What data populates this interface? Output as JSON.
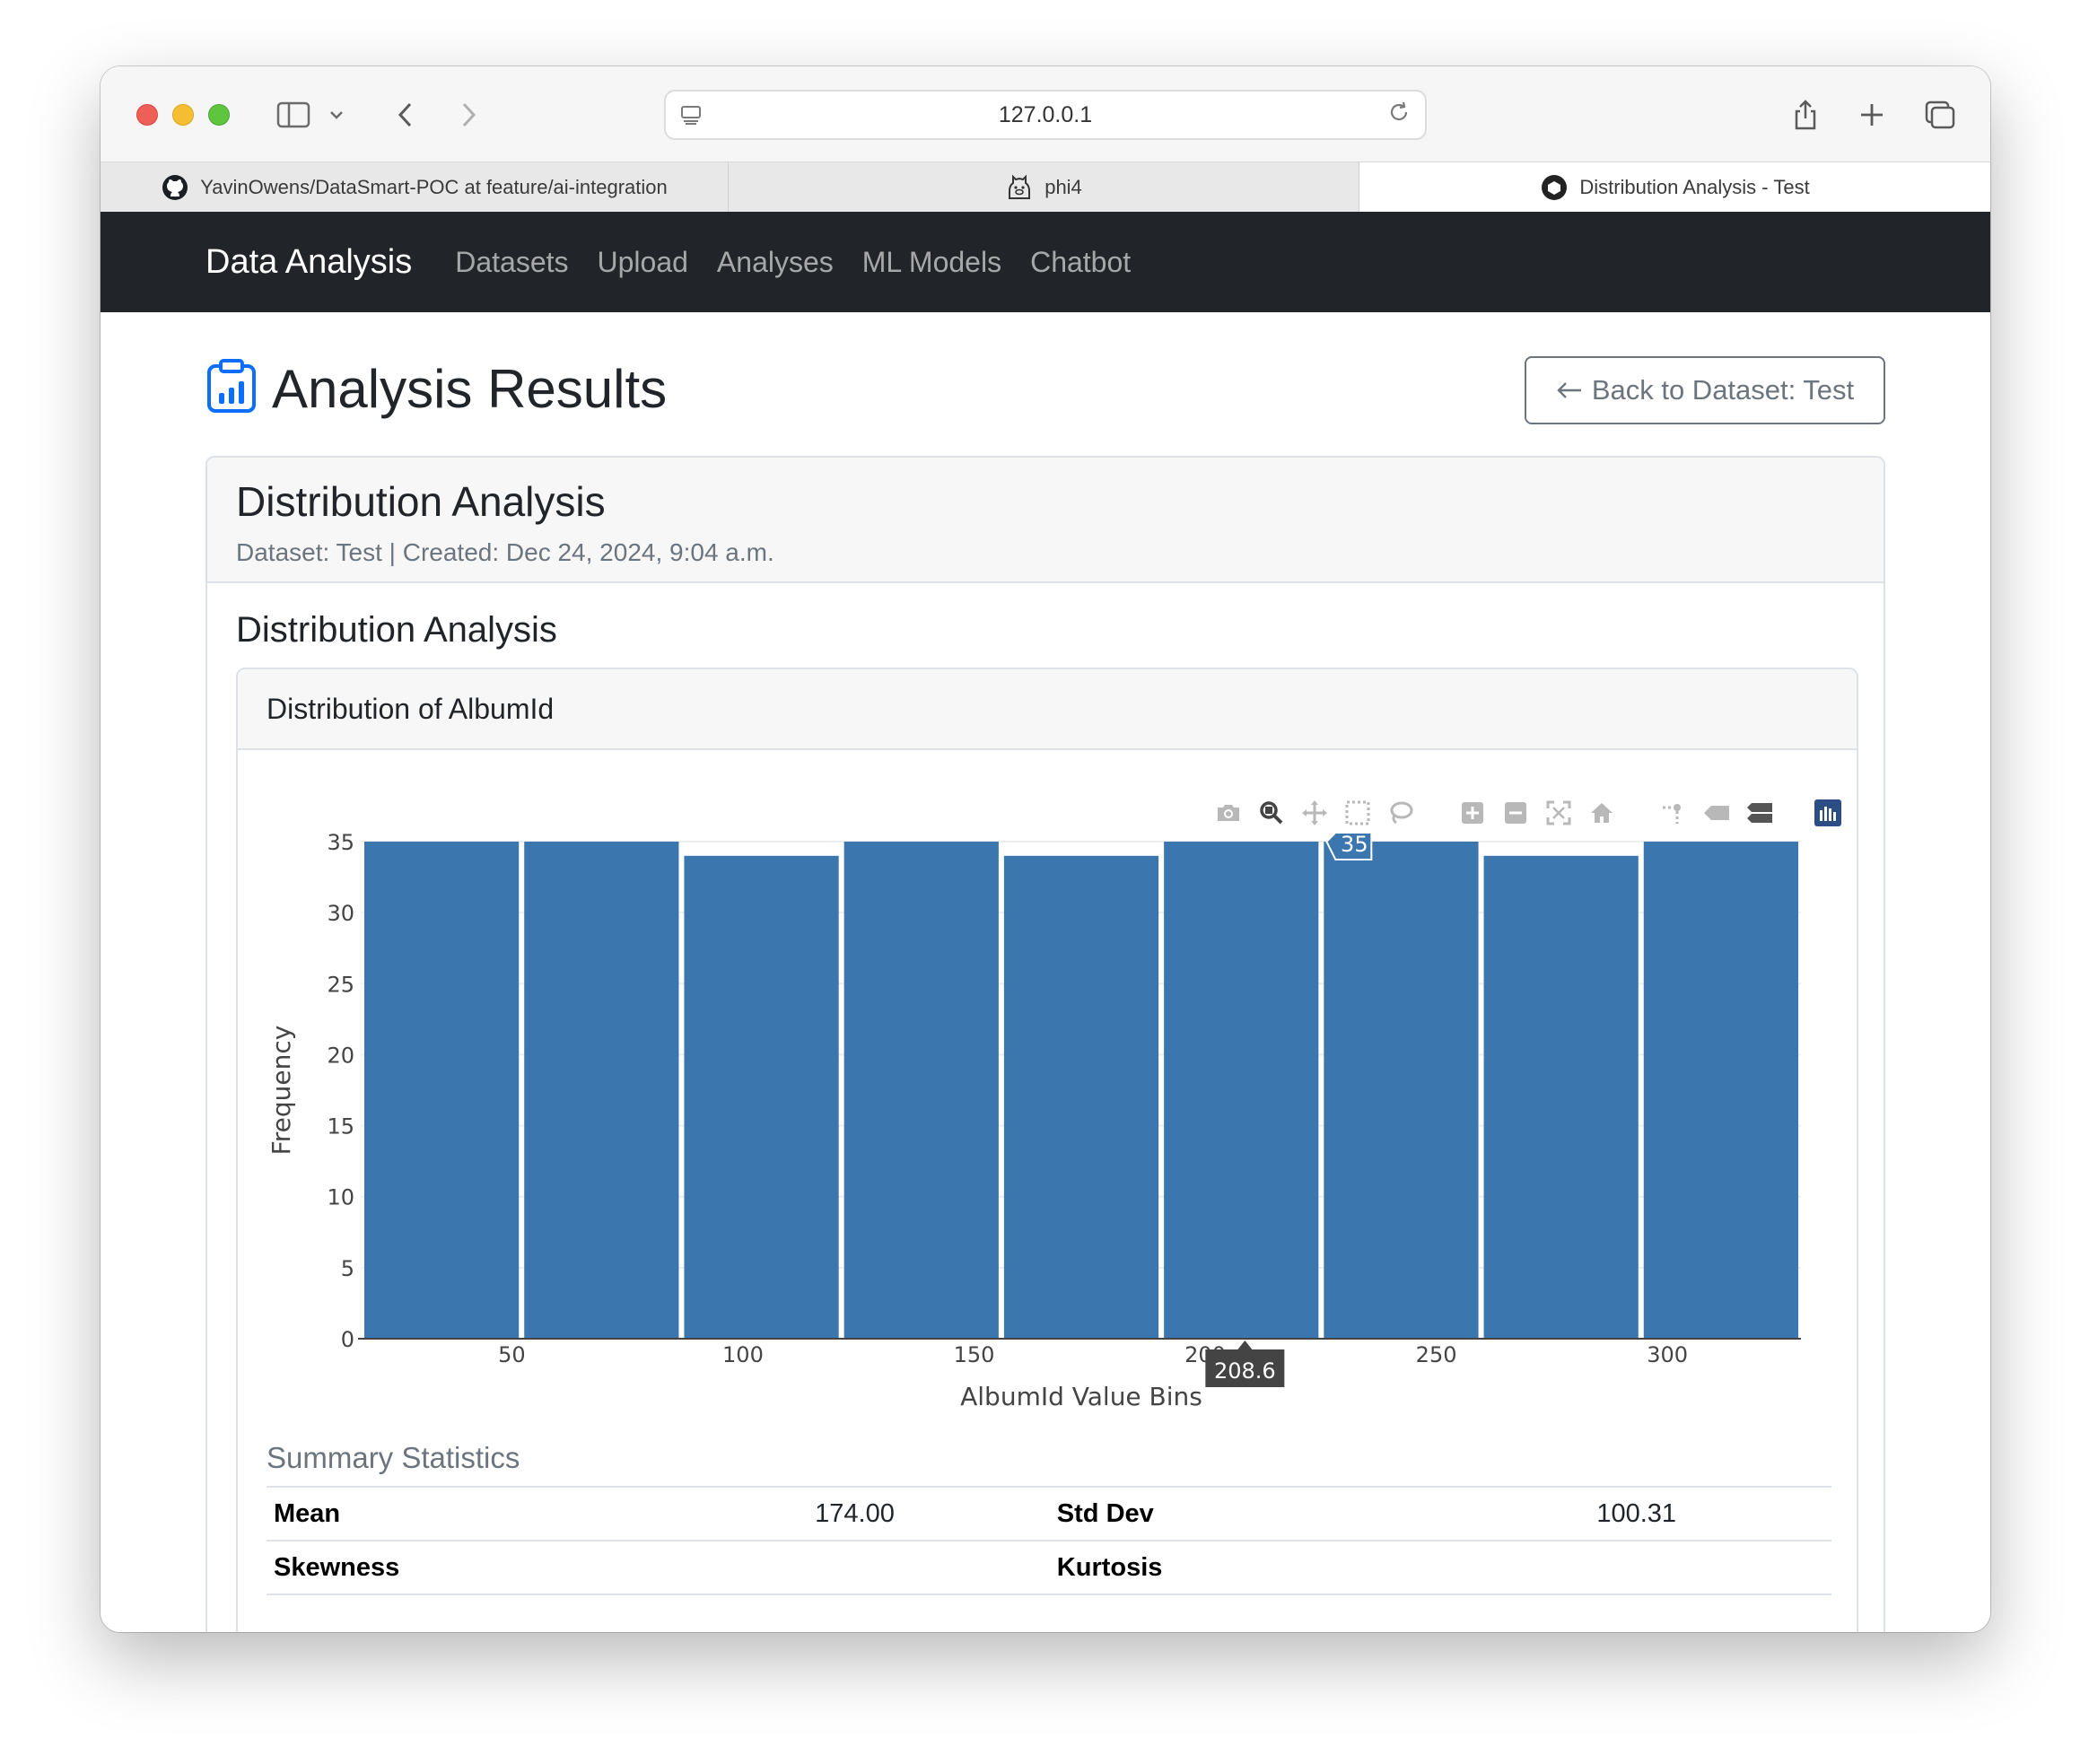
{
  "browser": {
    "url": "127.0.0.1",
    "tabs": [
      {
        "label": "YavinOwens/DataSmart-POC at feature/ai-integration"
      },
      {
        "label": "phi4"
      },
      {
        "label": "Distribution Analysis - Test"
      }
    ]
  },
  "navbar": {
    "brand": "Data Analysis",
    "links": [
      "Datasets",
      "Upload",
      "Analyses",
      "ML Models",
      "Chatbot"
    ]
  },
  "page": {
    "title": "Analysis Results",
    "back_button": "Back to Dataset: Test"
  },
  "card": {
    "title": "Distribution Analysis",
    "subtitle": "Dataset: Test | Created: Dec 24, 2024, 9:04 a.m.",
    "section_title": "Distribution Analysis",
    "chart_card_title": "Distribution of AlbumId"
  },
  "chart_data": {
    "type": "bar",
    "title": "",
    "xlabel": "AlbumId Value Bins",
    "ylabel": "Frequency",
    "bin_edges": [
      17.5,
      52.1,
      86.7,
      121.3,
      155.9,
      190.5,
      225.1,
      259.7,
      294.3,
      328.9
    ],
    "values": [
      35,
      35,
      34,
      35,
      34,
      35,
      35,
      34,
      35
    ],
    "xlim": [
      17.5,
      328.9
    ],
    "ylim": [
      0,
      35
    ],
    "xticks": [
      50,
      100,
      150,
      200,
      250,
      300
    ],
    "yticks": [
      0,
      5,
      10,
      15,
      20,
      25,
      30,
      35
    ],
    "bar_color": "#3b76af",
    "hover": {
      "y_label": "35",
      "x_label": "208.6",
      "x_value": 208.6,
      "y_value": 35
    }
  },
  "stats": {
    "title": "Summary Statistics",
    "rows": [
      {
        "label1": "Mean",
        "value1": "174.00",
        "label2": "Std Dev",
        "value2": "100.31"
      },
      {
        "label1": "Skewness",
        "value1": "",
        "label2": "Kurtosis",
        "value2": ""
      }
    ]
  },
  "colors": {
    "navbar_bg": "#212529",
    "bar": "#3b76af",
    "icon_blue": "#0d6efd"
  }
}
